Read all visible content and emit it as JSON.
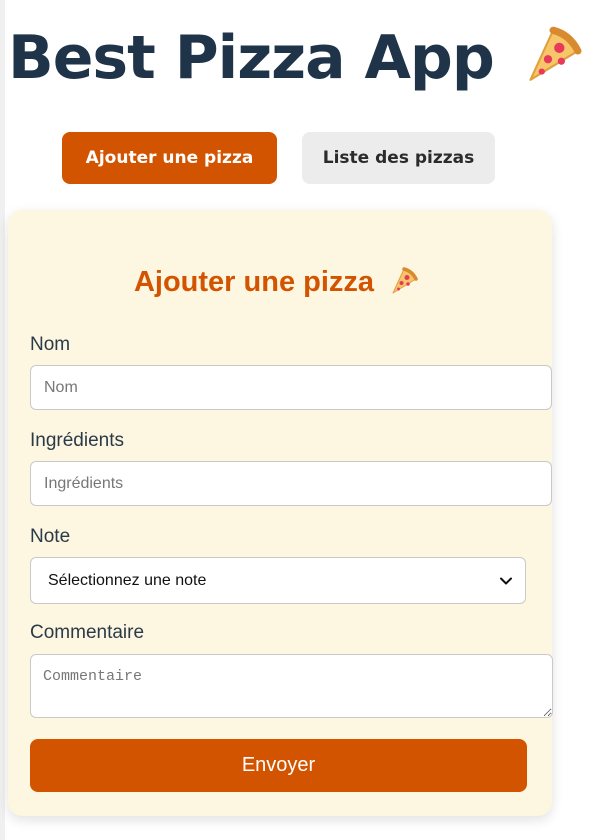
{
  "header": {
    "title": "Best Pizza App",
    "icon": "pizza-slice-icon"
  },
  "nav": {
    "items": [
      {
        "label": "Ajouter une pizza",
        "active": true
      },
      {
        "label": "Liste des pizzas",
        "active": false
      }
    ]
  },
  "form": {
    "title": "Ajouter une pizza",
    "title_icon": "pizza-slice-icon",
    "fields": {
      "nom": {
        "label": "Nom",
        "placeholder": "Nom",
        "value": ""
      },
      "ingredients": {
        "label": "Ingrédients",
        "placeholder": "Ingrédients",
        "value": ""
      },
      "note": {
        "label": "Note",
        "selected": "Sélectionnez une note"
      },
      "commentaire": {
        "label": "Commentaire",
        "placeholder": "Commentaire",
        "value": ""
      }
    },
    "submit_label": "Envoyer"
  },
  "colors": {
    "accent": "#d35400",
    "title": "#1f3349",
    "card_bg": "#fdf6e0",
    "secondary_button": "#ececec"
  }
}
